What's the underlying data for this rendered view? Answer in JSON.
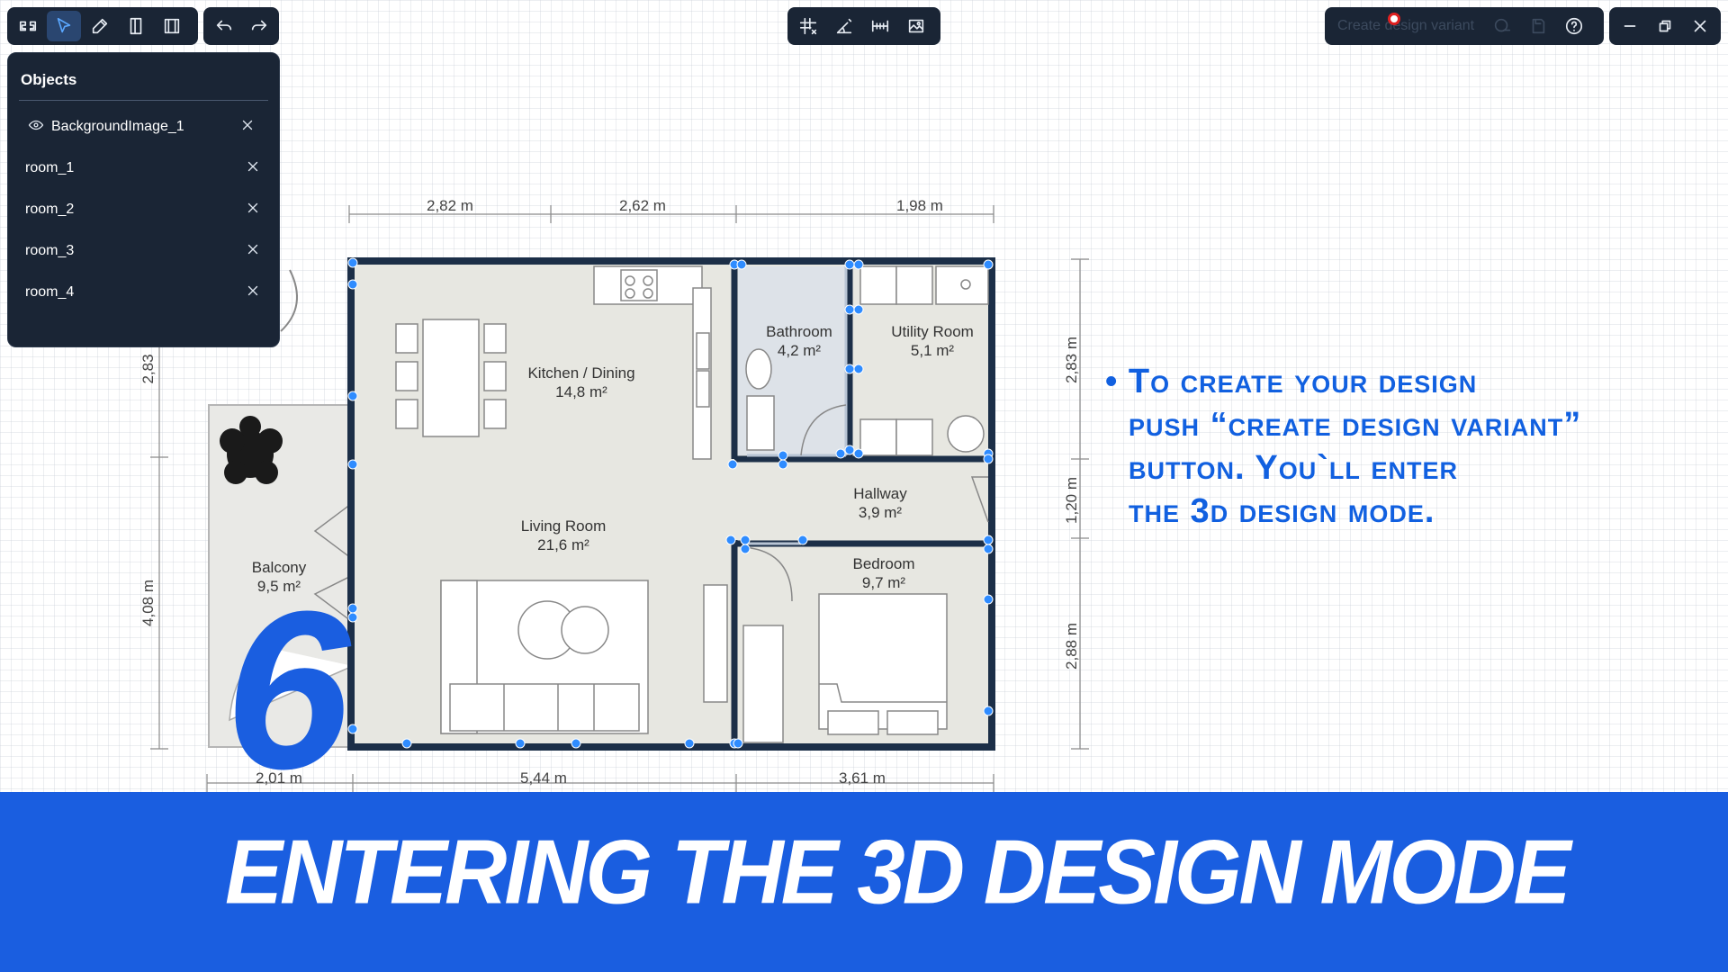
{
  "toolbar": {
    "tools": [
      "plan-view-icon",
      "select-icon",
      "pencil-icon",
      "door-icon",
      "window-icon"
    ],
    "undo_redo": [
      "undo-icon",
      "redo-icon"
    ],
    "center_tools": [
      "snap-grid-icon",
      "measure-angle-icon",
      "dimension-icon",
      "image-icon"
    ],
    "create_design_variant": "Create design variant",
    "right_icons": [
      "3d-view-icon",
      "save-icon",
      "help-icon"
    ],
    "window_controls": [
      "minimize-icon",
      "restore-icon",
      "close-icon"
    ]
  },
  "objects_panel": {
    "title": "Objects",
    "items": [
      {
        "label": "BackgroundImage_1",
        "visible_icon": "eye-icon"
      },
      {
        "label": "room_1"
      },
      {
        "label": "room_2"
      },
      {
        "label": "room_3"
      },
      {
        "label": "room_4"
      }
    ]
  },
  "floorplan": {
    "top_dims": [
      "2,82 m",
      "2,62 m",
      "1,98 m"
    ],
    "bottom_dims": [
      "2,01 m",
      "5,44 m",
      "3,61 m"
    ],
    "left_dims": [
      "2,83",
      "4,08 m"
    ],
    "right_dims": [
      "2,83 m",
      "1,20 m",
      "2,88 m"
    ],
    "rooms": [
      {
        "name": "Kitchen / Dining",
        "area": "14,8 m²"
      },
      {
        "name": "Bathroom",
        "area": "4,2 m²"
      },
      {
        "name": "Utility Room",
        "area": "5,1 m²"
      },
      {
        "name": "Hallway",
        "area": "3,9 m²"
      },
      {
        "name": "Living Room",
        "area": "21,6 m²"
      },
      {
        "name": "Bedroom",
        "area": "9,7 m²"
      },
      {
        "name": "Balcony",
        "area": "9,5 m²"
      }
    ]
  },
  "instructions": {
    "line1": "• To create your design",
    "line2": "push “create design variant”",
    "line3": "button. You`ll enter",
    "line4": "the 3d design mode."
  },
  "step_number": "6",
  "banner_title": "ENTERING THE 3D DESIGN MODE",
  "colors": {
    "accent": "#1a5ee0",
    "toolbar_bg": "#1a2535",
    "wall": "#1c2f48",
    "selection": "#2f8cff",
    "floor": "#e7e7e1"
  }
}
